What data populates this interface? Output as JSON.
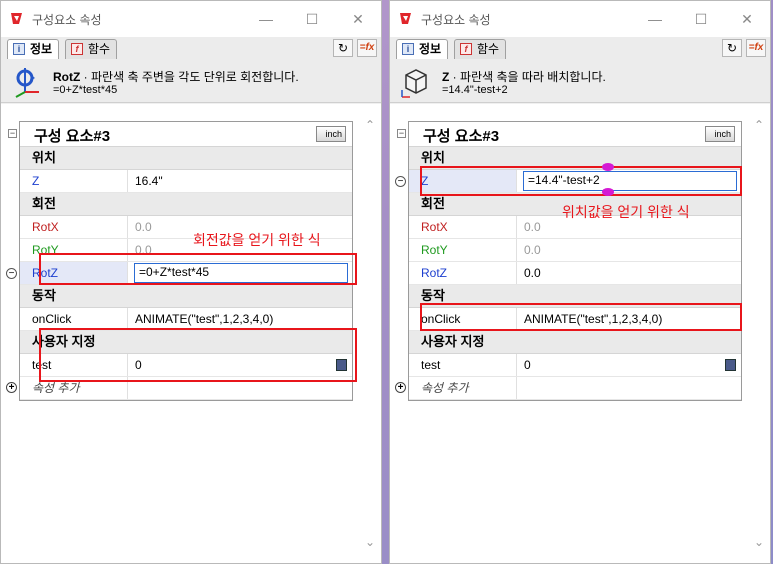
{
  "colors": {
    "accent": "#2b6cd4",
    "highlight_red": "#e8151b",
    "label_blue": "#1d3fcf",
    "label_red": "#c02020",
    "label_green": "#1f9a1f"
  },
  "left": {
    "window_title": "구성요소 속성",
    "tabs": [
      {
        "label": "정보",
        "icon": "info-icon"
      },
      {
        "label": "함수",
        "icon": "function-icon"
      }
    ],
    "info": {
      "name": "RotZ",
      "description": " · 파란색 축 주변을 각도 단위로 회전합니다.",
      "formula": "=0+Z*test*45"
    },
    "grid": {
      "title": "구성 요소#3",
      "unit_button": "inch",
      "sections": {
        "position": "위치",
        "rotation": "회전",
        "behavior": "동작",
        "custom": "사용자 지정"
      },
      "rows": {
        "z": {
          "label": "Z",
          "value": "16.4\""
        },
        "rotx": {
          "label": "RotX",
          "value": "0.0"
        },
        "roty": {
          "label": "RotY",
          "value": "0.0"
        },
        "rotz": {
          "label": "RotZ",
          "value": "=0+Z*test*45"
        },
        "onclick": {
          "label": "onClick",
          "value": "ANIMATE(\"test\",1,2,3,4,0)"
        },
        "test": {
          "label": "test",
          "value": "0"
        }
      },
      "add_property": "속성 추가"
    },
    "annotation": "회전값을 얻기 위한 식"
  },
  "right": {
    "window_title": "구성요소 속성",
    "tabs": [
      {
        "label": "정보",
        "icon": "info-icon"
      },
      {
        "label": "함수",
        "icon": "function-icon"
      }
    ],
    "info": {
      "name": "Z",
      "description": " · 파란색 축을 따라 배치합니다.",
      "formula": "=14.4\"-test+2"
    },
    "grid": {
      "title": "구성 요소#3",
      "unit_button": "inch",
      "sections": {
        "position": "위치",
        "rotation": "회전",
        "behavior": "동작",
        "custom": "사용자 지정"
      },
      "rows": {
        "z": {
          "label": "Z",
          "value": "=14.4\"-test+2"
        },
        "rotx": {
          "label": "RotX",
          "value": "0.0"
        },
        "roty": {
          "label": "RotY",
          "value": "0.0"
        },
        "rotz": {
          "label": "RotZ",
          "value": "0.0"
        },
        "onclick": {
          "label": "onClick",
          "value": "ANIMATE(\"test\",1,2,3,4,0)"
        },
        "test": {
          "label": "test",
          "value": "0"
        }
      },
      "add_property": "속성 추가"
    },
    "annotation": "위치값을 얻기 위한 식"
  }
}
